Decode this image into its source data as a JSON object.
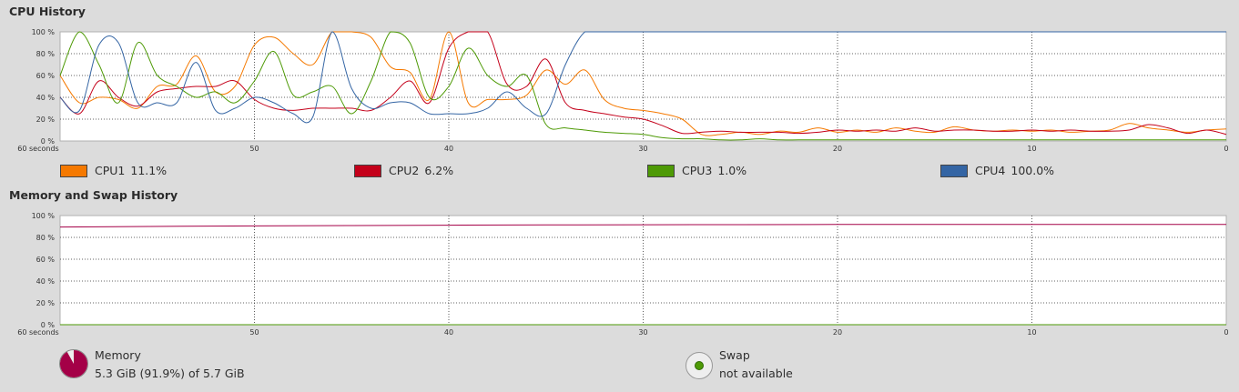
{
  "cpu": {
    "title": "CPU History",
    "y_ticks": [
      "100 %",
      "80 %",
      "60 %",
      "40 %",
      "20 %",
      "0 %"
    ],
    "x_ticks": [
      "60 seconds",
      "50",
      "40",
      "30",
      "20",
      "10",
      "0"
    ],
    "legend": [
      {
        "label": "CPU1",
        "value": "11.1%",
        "color": "#f57900"
      },
      {
        "label": "CPU2",
        "value": "6.2%",
        "color": "#c4001a"
      },
      {
        "label": "CPU3",
        "value": "1.0%",
        "color": "#4e9a06"
      },
      {
        "label": "CPU4",
        "value": "100.0%",
        "color": "#3465a4"
      }
    ]
  },
  "memory": {
    "title": "Memory and Swap History",
    "y_ticks": [
      "100 %",
      "80 %",
      "60 %",
      "40 %",
      "20 %",
      "0 %"
    ],
    "x_ticks": [
      "60 seconds",
      "50",
      "40",
      "30",
      "20",
      "10",
      "0"
    ],
    "mem_label": "Memory",
    "mem_value": "5.3 GiB (91.9%) of 5.7 GiB",
    "mem_fraction": 0.919,
    "mem_color": "#a40047",
    "swap_label": "Swap",
    "swap_value": "not available",
    "swap_color": "#4e9a06"
  },
  "chart_data": [
    {
      "type": "line",
      "title": "CPU History",
      "xlabel": "",
      "ylabel": "",
      "xlim": [
        60,
        0
      ],
      "ylim": [
        0,
        100
      ],
      "grid": true,
      "x": [
        60,
        59,
        58,
        57,
        56,
        55,
        54,
        53,
        52,
        51,
        50,
        49,
        48,
        47,
        46,
        45,
        44,
        43,
        42,
        41,
        40,
        39,
        38,
        37,
        36,
        35,
        34,
        33,
        32,
        31,
        30,
        29,
        28,
        27,
        26,
        25,
        24,
        23,
        22,
        21,
        20,
        19,
        18,
        17,
        16,
        15,
        14,
        13,
        12,
        11,
        10,
        9,
        8,
        7,
        6,
        5,
        4,
        3,
        2,
        1,
        0
      ],
      "series": [
        {
          "name": "CPU1",
          "values": [
            60,
            35,
            40,
            38,
            30,
            50,
            52,
            78,
            45,
            50,
            88,
            95,
            80,
            70,
            100,
            100,
            95,
            68,
            63,
            38,
            100,
            35,
            38,
            38,
            42,
            65,
            52,
            65,
            38,
            30,
            28,
            25,
            20,
            6,
            6,
            8,
            6,
            9,
            8,
            12,
            8,
            10,
            8,
            12,
            9,
            8,
            13,
            10,
            9,
            10,
            9,
            10,
            8,
            9,
            10,
            16,
            12,
            10,
            8,
            10,
            11
          ]
        },
        {
          "name": "CPU2",
          "values": [
            40,
            25,
            55,
            40,
            32,
            45,
            48,
            50,
            50,
            55,
            38,
            30,
            28,
            30,
            30,
            30,
            28,
            40,
            55,
            35,
            85,
            100,
            100,
            52,
            50,
            75,
            35,
            28,
            25,
            22,
            20,
            14,
            7,
            8,
            9,
            8,
            8,
            8,
            7,
            8,
            10,
            9,
            10,
            9,
            12,
            9,
            10,
            10,
            9,
            9,
            10,
            9,
            10,
            9,
            9,
            10,
            15,
            12,
            7,
            10,
            6
          ]
        },
        {
          "name": "CPU3",
          "values": [
            60,
            100,
            70,
            35,
            90,
            60,
            50,
            40,
            45,
            35,
            55,
            82,
            42,
            45,
            50,
            25,
            55,
            100,
            90,
            40,
            50,
            85,
            60,
            50,
            60,
            15,
            12,
            10,
            8,
            7,
            6,
            3,
            2,
            2,
            1,
            1,
            2,
            1,
            1,
            1,
            1,
            1,
            1,
            1,
            1,
            1,
            1,
            1,
            1,
            1,
            1,
            1,
            1,
            1,
            1,
            1,
            1,
            1,
            1,
            1,
            1
          ]
        },
        {
          "name": "CPU4",
          "values": [
            40,
            28,
            88,
            90,
            35,
            35,
            35,
            72,
            28,
            30,
            40,
            35,
            25,
            22,
            100,
            48,
            30,
            35,
            35,
            25,
            25,
            25,
            30,
            45,
            30,
            25,
            70,
            100,
            100,
            100,
            100,
            100,
            100,
            100,
            100,
            100,
            100,
            100,
            100,
            100,
            100,
            100,
            100,
            100,
            100,
            100,
            100,
            100,
            100,
            100,
            100,
            100,
            100,
            100,
            100,
            100,
            100,
            100,
            100,
            100,
            100
          ]
        }
      ]
    },
    {
      "type": "line",
      "title": "Memory and Swap History",
      "xlabel": "",
      "ylabel": "",
      "xlim": [
        60,
        0
      ],
      "ylim": [
        0,
        100
      ],
      "grid": true,
      "x": [
        60,
        50,
        40,
        30,
        20,
        10,
        0
      ],
      "series": [
        {
          "name": "Memory",
          "values": [
            89.5,
            90.5,
            91.2,
            91.6,
            91.8,
            91.9,
            91.9
          ]
        },
        {
          "name": "Swap",
          "values": [
            0,
            0,
            0,
            0,
            0,
            0,
            0
          ]
        }
      ]
    }
  ]
}
